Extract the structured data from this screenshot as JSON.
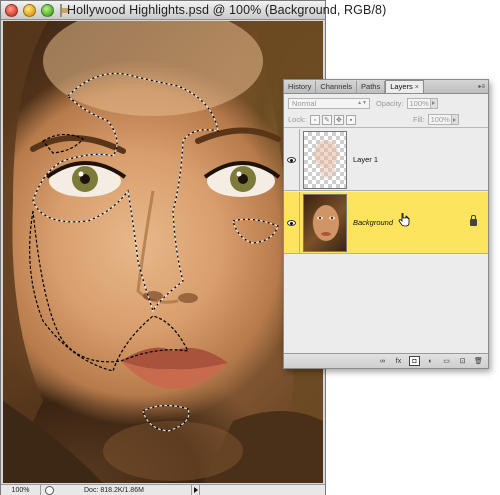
{
  "document": {
    "title": "Hollywood Highlights.psd @ 100% (Background, RGB/8)",
    "status": {
      "zoom": "100%",
      "doc_info": "Doc: 818.2K/1.86M"
    }
  },
  "panel": {
    "tabs": [
      {
        "label": "History",
        "active": false
      },
      {
        "label": "Channels",
        "active": false
      },
      {
        "label": "Paths",
        "active": false
      },
      {
        "label": "Layers",
        "active": true
      }
    ],
    "tab_close": "×",
    "blend_mode": "Normal",
    "opacity_label": "Opacity:",
    "opacity_value": "100%",
    "lock_label": "Lock:",
    "fill_label": "Fill:",
    "fill_value": "100%",
    "layers": [
      {
        "name": "Layer 1",
        "visible": true,
        "selected": false,
        "thumbnail": "transparent-checker"
      },
      {
        "name": "Background",
        "visible": true,
        "selected": true,
        "locked": true,
        "thumbnail": "photo"
      }
    ],
    "footer_buttons": [
      "link-icon",
      "fx-icon",
      "mask-icon",
      "adjustment-icon",
      "folder-icon",
      "new-layer-icon",
      "trash-icon"
    ],
    "footer_labels": {
      "fx": "fx"
    },
    "selected_color": "#fde45e"
  }
}
